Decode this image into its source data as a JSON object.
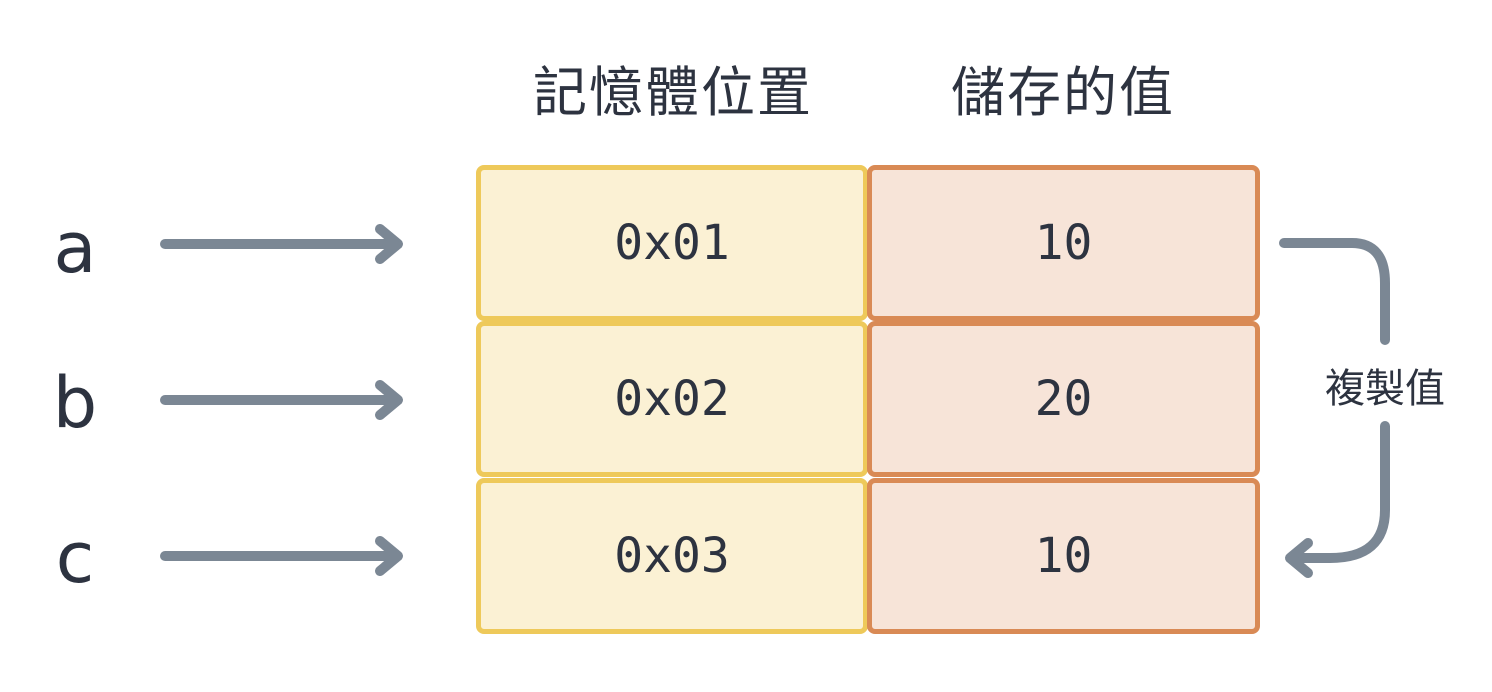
{
  "headers": {
    "address": "記憶體位置",
    "value": "儲存的值"
  },
  "rows": [
    {
      "variable": "a",
      "address": "0x01",
      "value": "10"
    },
    {
      "variable": "b",
      "address": "0x02",
      "value": "20"
    },
    {
      "variable": "c",
      "address": "0x03",
      "value": "10"
    }
  ],
  "copy_label": "複製值",
  "colors": {
    "arrow": "#7b8794",
    "address_fill": "#fbf1d4",
    "address_border": "#eec95a",
    "value_fill": "#f7e4d8",
    "value_border": "#d98a55",
    "text": "#2d3340"
  }
}
